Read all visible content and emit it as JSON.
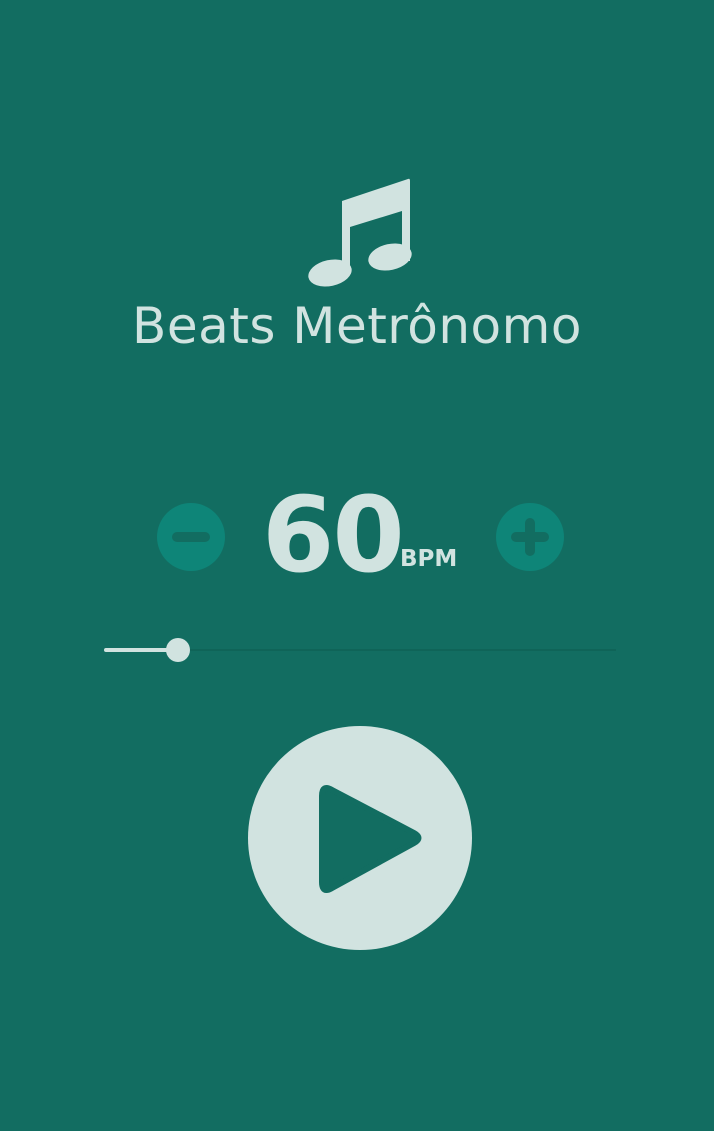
{
  "app": {
    "title": "Beats Metrônomo",
    "logo_icon": "music-note-icon"
  },
  "tempo": {
    "value": "60",
    "unit": "BPM",
    "decrease_icon": "minus-circle-icon",
    "increase_icon": "plus-circle-icon"
  },
  "slider": {
    "value_fraction": 0.145
  },
  "playback": {
    "play_icon": "play-icon"
  },
  "colors": {
    "background": "#126D61",
    "foreground": "#D1E3E0",
    "button_fill": "#0E8578"
  }
}
